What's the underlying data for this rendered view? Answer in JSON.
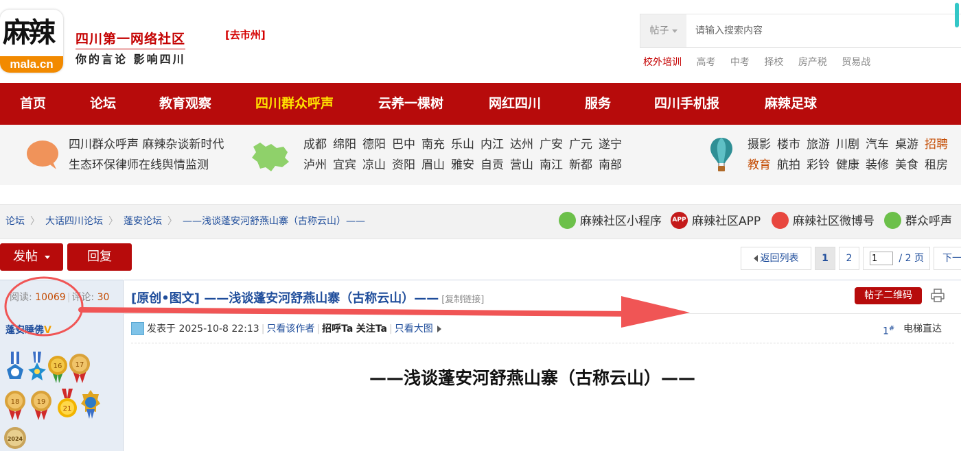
{
  "header": {
    "logo_text": "麻辣",
    "logo_domain": "mala.cn",
    "slogan_main": "四川第一网络社区",
    "slogan_sub": "你的言论 影响四川",
    "city_link": "[去市州]",
    "search": {
      "type_label": "帖子",
      "placeholder": "请输入搜索内容"
    },
    "hot_words": [
      "校外培训",
      "高考",
      "中考",
      "择校",
      "房产税",
      "贸易战"
    ]
  },
  "nav": {
    "items": [
      "首页",
      "论坛",
      "教育观察",
      "四川群众呼声",
      "云养一棵树",
      "网红四川",
      "服务",
      "四川手机报",
      "麻辣足球"
    ],
    "active_index": 3,
    "bg_color": "#b70b0b",
    "active_color": "#ffe100"
  },
  "channels": {
    "left_row1": "四川群众呼声 麻辣杂谈新时代",
    "left_row2": "生态环保律师在线舆情监测",
    "cities_row1": [
      "成都",
      "绵阳",
      "德阳",
      "巴中",
      "南充",
      "乐山",
      "内江",
      "达州",
      "广安",
      "广元",
      "遂宁"
    ],
    "cities_row2": [
      "泸州",
      "宜宾",
      "凉山",
      "资阳",
      "眉山",
      "雅安",
      "自贡",
      "营山",
      "南江",
      "新都",
      "南部"
    ],
    "topics_row1": [
      "摄影",
      "楼市",
      "旅游",
      "川剧",
      "汽车",
      "桌游",
      "招聘"
    ],
    "topics_row2": [
      "教育",
      "航拍",
      "彩铃",
      "健康",
      "装修",
      "美食",
      "租房"
    ],
    "icons": [
      "speech-bubble-icon",
      "sichuan-map-icon",
      "hot-air-balloon-icon"
    ]
  },
  "breadcrumb": [
    "论坛",
    "大话四川论坛",
    "蓬安论坛",
    "——浅谈蓬安河舒燕山寨（古称云山）——"
  ],
  "social": [
    "麻辣社区小程序",
    "麻辣社区APP",
    "麻辣社区微博号",
    "群众呼声"
  ],
  "actions": {
    "post_label": "发帖",
    "reply_label": "回复",
    "back_label": "返回列表",
    "pages": [
      "1",
      "2"
    ],
    "page_input": "1",
    "total_pages": "/ 2 页",
    "next_label": "下一页"
  },
  "post": {
    "stats_read_label": "阅读:",
    "stats_read": "10069",
    "stats_comment_label": "评论:",
    "stats_comment": "30",
    "author": "蓬安睡佛",
    "author_badge": "V",
    "title": "[原创•图文] ——浅谈蓬安河舒燕山寨（古称云山）——",
    "copy_link": "[复制链接]",
    "qr_button": "帖子二维码",
    "posted_at": "发表于 2025-10-8 22:13",
    "only_author": "只看该作者",
    "greet": "招呼Ta",
    "follow": "关注Ta",
    "big_image": "只看大图",
    "floor": "1",
    "floor_mark": "#",
    "elevator": "电梯直达",
    "heading": "——浅谈蓬安河舒燕山寨（古称云山）——",
    "medal_labels": [
      "16",
      "17",
      "18",
      "19",
      "21",
      "2024"
    ]
  },
  "colors": {
    "brand_red": "#b70b0b",
    "link_blue": "#1f4d9b",
    "annotation_red": "#f05555"
  }
}
